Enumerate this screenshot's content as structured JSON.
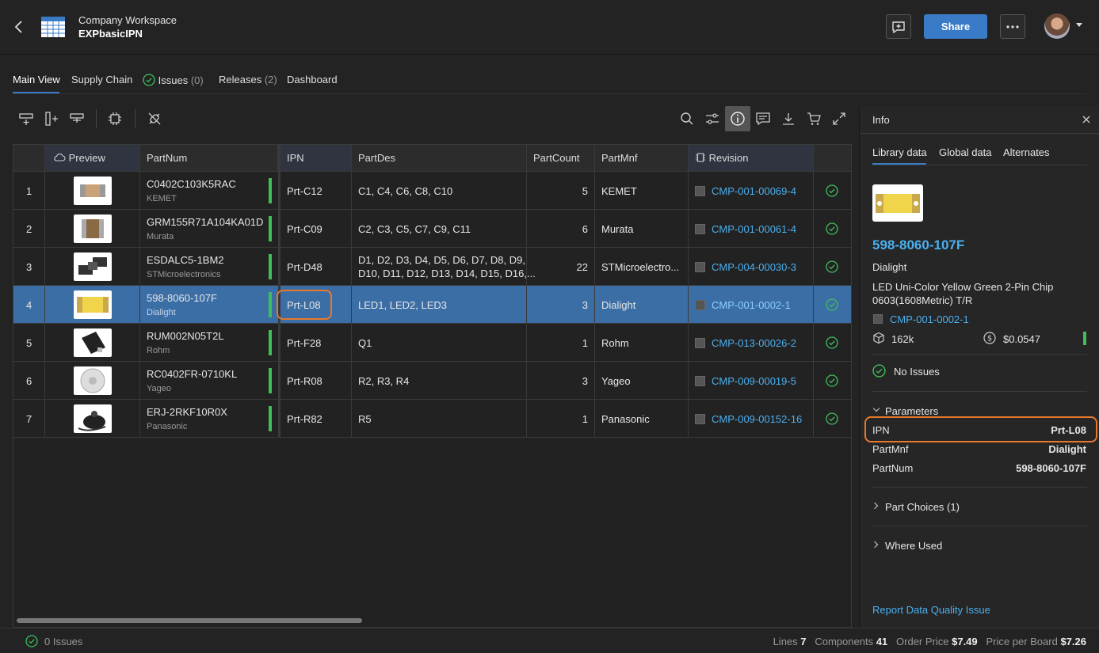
{
  "header": {
    "workspace": "Company Workspace",
    "project": "EXPbasicIPN",
    "share_label": "Share"
  },
  "tabs": [
    {
      "label": "Main View"
    },
    {
      "label": "Supply Chain"
    },
    {
      "label": "Issues",
      "count": "(0)"
    },
    {
      "label": "Releases",
      "count": "(2)"
    },
    {
      "label": "Dashboard"
    }
  ],
  "table": {
    "columns": [
      "Preview",
      "PartNum",
      "IPN",
      "PartDes",
      "PartCount",
      "PartMnf",
      "Revision"
    ],
    "rows": [
      {
        "n": "1",
        "partnum": "C0402C103K5RAC",
        "mnf_sub": "KEMET",
        "ipn": "Prt-C12",
        "partdes": "C1, C4, C6, C8, C10",
        "partdes2": "",
        "count": "5",
        "mnf": "KEMET",
        "rev": "CMP-001-00069-4"
      },
      {
        "n": "2",
        "partnum": "GRM155R71A104KA01D",
        "mnf_sub": "Murata",
        "ipn": "Prt-C09",
        "partdes": "C2, C3, C5, C7, C9, C11",
        "partdes2": "",
        "count": "6",
        "mnf": "Murata",
        "rev": "CMP-001-00061-4"
      },
      {
        "n": "3",
        "partnum": "ESDALC5-1BM2",
        "mnf_sub": "STMicroelectronics",
        "ipn": "Prt-D48",
        "partdes": "D1, D2, D3, D4, D5, D6, D7, D8, D9,",
        "partdes2": "D10, D11, D12, D13, D14, D15, D16,...",
        "count": "22",
        "mnf": "STMicroelectro...",
        "rev": "CMP-004-00030-3"
      },
      {
        "n": "4",
        "partnum": "598-8060-107F",
        "mnf_sub": "Dialight",
        "ipn": "Prt-L08",
        "partdes": "LED1, LED2, LED3",
        "partdes2": "",
        "count": "3",
        "mnf": "Dialight",
        "rev": "CMP-001-0002-1"
      },
      {
        "n": "5",
        "partnum": "RUM002N05T2L",
        "mnf_sub": "Rohm",
        "ipn": "Prt-F28",
        "partdes": "Q1",
        "partdes2": "",
        "count": "1",
        "mnf": "Rohm",
        "rev": "CMP-013-00026-2"
      },
      {
        "n": "6",
        "partnum": "RC0402FR-0710KL",
        "mnf_sub": "Yageo",
        "ipn": "Prt-R08",
        "partdes": "R2, R3, R4",
        "partdes2": "",
        "count": "3",
        "mnf": "Yageo",
        "rev": "CMP-009-00019-5"
      },
      {
        "n": "7",
        "partnum": "ERJ-2RKF10R0X",
        "mnf_sub": "Panasonic",
        "ipn": "Prt-R82",
        "partdes": "R5",
        "partdes2": "",
        "count": "1",
        "mnf": "Panasonic",
        "rev": "CMP-009-00152-16"
      }
    ]
  },
  "info": {
    "title": "Info",
    "tabs": [
      "Library data",
      "Global data",
      "Alternates"
    ],
    "partnum": "598-8060-107F",
    "manufacturer": "Dialight",
    "desc1": "LED Uni-Color Yellow Green 2-Pin Chip",
    "desc2": "0603(1608Metric) T/R",
    "revision": "CMP-001-0002-1",
    "stock": "162k",
    "price": "$0.0547",
    "issues": "No Issues",
    "parameters_label": "Parameters",
    "params": [
      {
        "k": "IPN",
        "v": "Prt-L08"
      },
      {
        "k": "PartMnf",
        "v": "Dialight"
      },
      {
        "k": "PartNum",
        "v": "598-8060-107F"
      }
    ],
    "part_choices": "Part Choices (1)",
    "where_used": "Where Used",
    "report": "Report Data Quality Issue"
  },
  "footer": {
    "issues": "0 Issues",
    "lines_label": "Lines",
    "lines": "7",
    "components_label": "Components",
    "components": "41",
    "order_label": "Order Price",
    "order": "$7.49",
    "board_label": "Price per Board",
    "board": "$7.26"
  }
}
